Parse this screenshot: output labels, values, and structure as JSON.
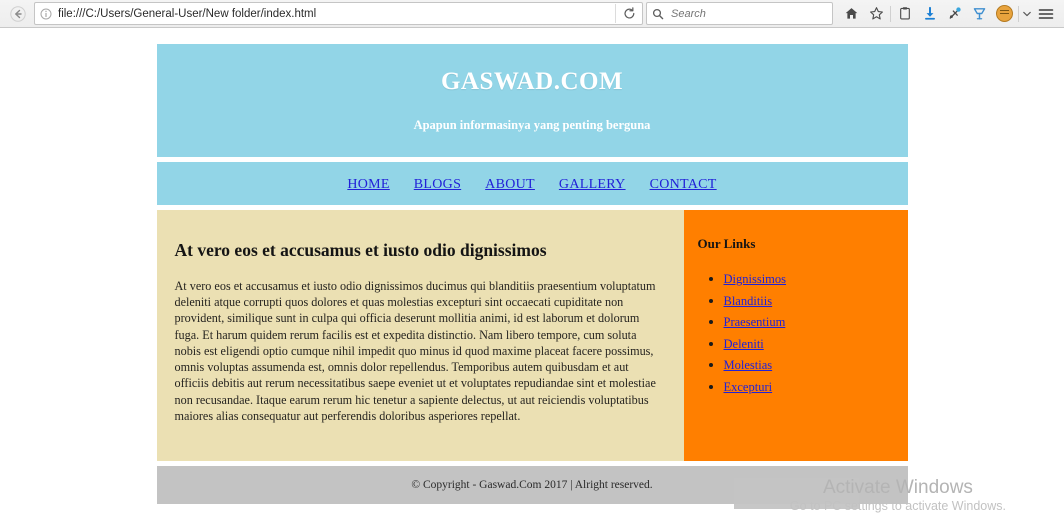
{
  "browser": {
    "back_label": "Back",
    "identity_icon": "info-icon",
    "url": "file:///C:/Users/General-User/New folder/index.html",
    "reload_label": "⟳",
    "search_placeholder": "Search",
    "search_value": "",
    "toolbar_icons": [
      {
        "name": "home-icon",
        "glyph": "⌂"
      },
      {
        "name": "bookmark-star-icon",
        "glyph": "☆"
      },
      {
        "name": "library-icon",
        "glyph": "὜2"
      },
      {
        "name": "download-icon",
        "glyph": "↓"
      },
      {
        "name": "sync-icon",
        "glyph": "↻"
      },
      {
        "name": "pocket-icon",
        "glyph": "Ⓥ"
      },
      {
        "name": "account-avatar-icon",
        "glyph": "●"
      },
      {
        "name": "chevron-down-icon",
        "glyph": "▼"
      },
      {
        "name": "hamburger-menu-icon",
        "glyph": "☰"
      }
    ]
  },
  "site": {
    "title": "GASWAD.COM",
    "tagline": "Apapun informasinya yang penting berguna",
    "nav": [
      {
        "label": "HOME"
      },
      {
        "label": "BLOGS"
      },
      {
        "label": "ABOUT"
      },
      {
        "label": "GALLERY"
      },
      {
        "label": "CONTACT"
      }
    ],
    "content": {
      "heading": "At vero eos et accusamus et iusto odio dignissimos",
      "paragraph": "At vero eos et accusamus et iusto odio dignissimos ducimus qui blanditiis praesentium voluptatum deleniti atque corrupti quos dolores et quas molestias excepturi sint occaecati cupiditate non provident, similique sunt in culpa qui officia deserunt mollitia animi, id est laborum et dolorum fuga. Et harum quidem rerum facilis est et expedita distinctio. Nam libero tempore, cum soluta nobis est eligendi optio cumque nihil impedit quo minus id quod maxime placeat facere possimus, omnis voluptas assumenda est, omnis dolor repellendus. Temporibus autem quibusdam et aut officiis debitis aut rerum necessitatibus saepe eveniet ut et voluptates repudiandae sint et molestiae non recusandae. Itaque earum rerum hic tenetur a sapiente delectus, ut aut reiciendis voluptatibus maiores alias consequatur aut perferendis doloribus asperiores repellat."
    },
    "sidebar": {
      "title": "Our Links",
      "links": [
        {
          "label": "Dignissimos"
        },
        {
          "label": "Blanditiis"
        },
        {
          "label": "Praesentium"
        },
        {
          "label": "Deleniti"
        },
        {
          "label": "Molestias"
        },
        {
          "label": "Excepturi"
        }
      ]
    },
    "footer": {
      "text": "© Copyright - Gaswad.Com 2017 | Alright reserved."
    },
    "colors": {
      "header_blue": "#92d5e7",
      "content_beige": "#ebe0b3",
      "sidebar_orange": "#ff7f00",
      "footer_gray": "#c3c3c3",
      "link_blue": "#2121d8"
    }
  },
  "watermark": {
    "title": "Activate Windows",
    "subtitle": "Go to PC settings to activate Windows."
  }
}
